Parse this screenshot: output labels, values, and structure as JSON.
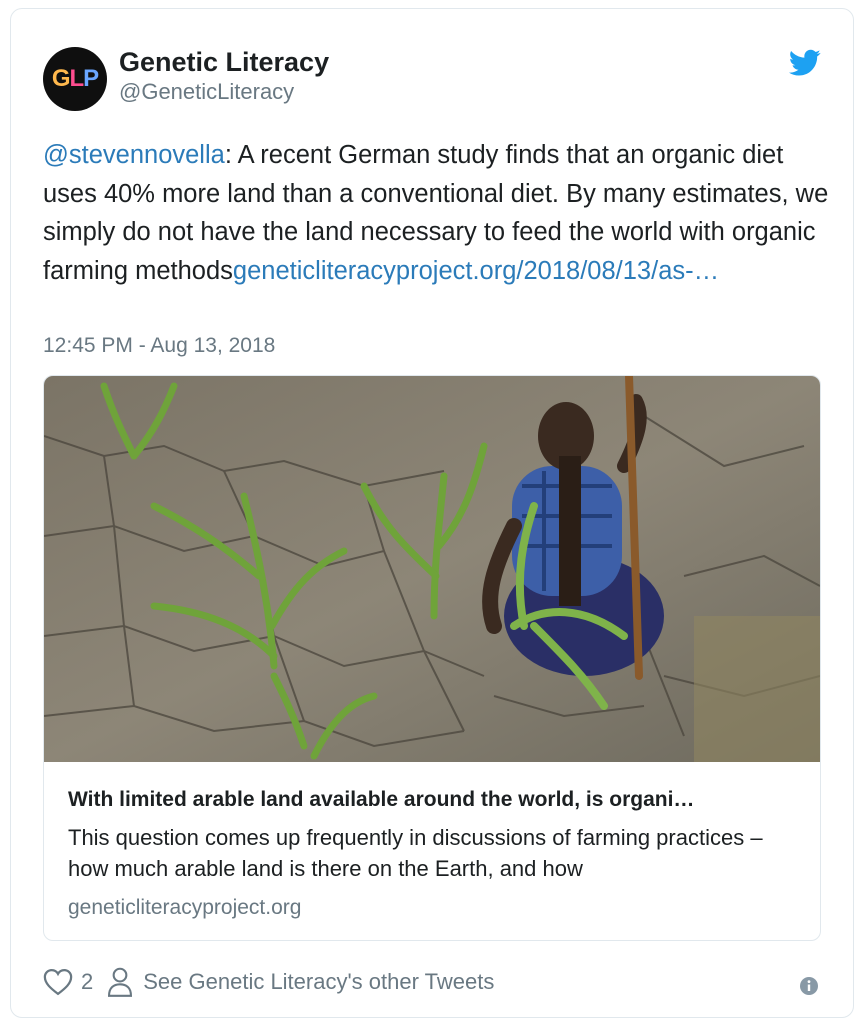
{
  "author": {
    "name": "Genetic Literacy",
    "handle": "@GeneticLiteracy",
    "avatar_text": [
      "G",
      "L",
      "P"
    ]
  },
  "tweet": {
    "mention": "@stevennovella",
    "body": ": A recent German study finds that an organic diet uses 40% more land than a conventional diet. By many estimates, we simply do not have the land necessary to feed the world with organic farming methods",
    "link": "geneticliteracyproject.org/2018/08/13/as-…",
    "timestamp": "12:45 PM - Aug 13, 2018"
  },
  "card": {
    "title": "With limited arable land available around the world, is organi…",
    "description": "This question comes up frequently in discussions of farming practices – how much arable land is there on the Earth, and how",
    "domain": "geneticliteracyproject.org"
  },
  "actions": {
    "like_count": "2",
    "see_other": "See Genetic Literacy's other Tweets"
  },
  "icons": {
    "brand": "twitter-bird-icon",
    "like": "heart-icon",
    "profile": "person-icon",
    "info": "info-icon"
  },
  "colors": {
    "link": "#2b7bb9",
    "twitter_blue": "#1da1f2",
    "secondary_text": "#697882",
    "primary_text": "#1c2022",
    "border": "#e1e8ed"
  }
}
